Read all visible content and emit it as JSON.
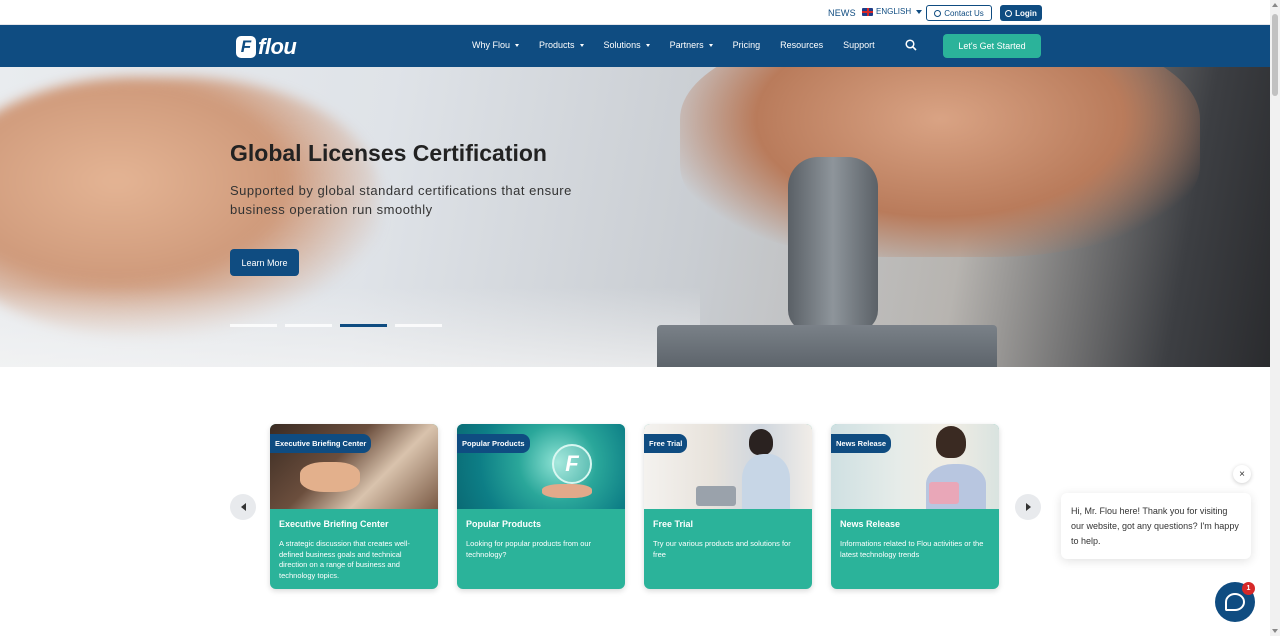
{
  "topbar": {
    "news": "NEWS",
    "language": "ENGLISH",
    "contact_label": "Contact Us",
    "login_label": "Login"
  },
  "nav": {
    "logo_text": "flou",
    "logo_mark": "F",
    "items": [
      {
        "label": "Why Flou",
        "dropdown": true
      },
      {
        "label": "Products",
        "dropdown": true
      },
      {
        "label": "Solutions",
        "dropdown": true
      },
      {
        "label": "Partners",
        "dropdown": true
      },
      {
        "label": "Pricing",
        "dropdown": false
      },
      {
        "label": "Resources",
        "dropdown": false
      },
      {
        "label": "Support",
        "dropdown": false
      }
    ],
    "cta_label": "Let's Get Started"
  },
  "hero": {
    "title": "Global Licenses Certification",
    "subtitle": "Supported by global standard certifications that ensure business operation run smoothly",
    "button_label": "Learn More",
    "slide_count": 4,
    "active_slide": 3
  },
  "cards": [
    {
      "tag": "Executive Briefing Center",
      "title": "Executive Briefing Center",
      "description": "A strategic discussion that creates well-defined business goals and technical direction on a range of business and technology topics."
    },
    {
      "tag": "Popular Products",
      "title": "Popular Products",
      "description": "Looking for popular products from our technology?"
    },
    {
      "tag": "Free Trial",
      "title": "Free Trial",
      "description": "Try our various products and solutions for free"
    },
    {
      "tag": "News Release",
      "title": "News Release",
      "description": "Informations related to Flou activities or the latest technology trends"
    }
  ],
  "chat": {
    "message": "Hi, Mr. Flou here! Thank you for visiting our website, got any questions? I'm happy to help.",
    "close": "×",
    "badge_count": "1"
  },
  "colors": {
    "primary": "#0f4c81",
    "accent": "#2bb39a",
    "badge": "#d62828"
  }
}
